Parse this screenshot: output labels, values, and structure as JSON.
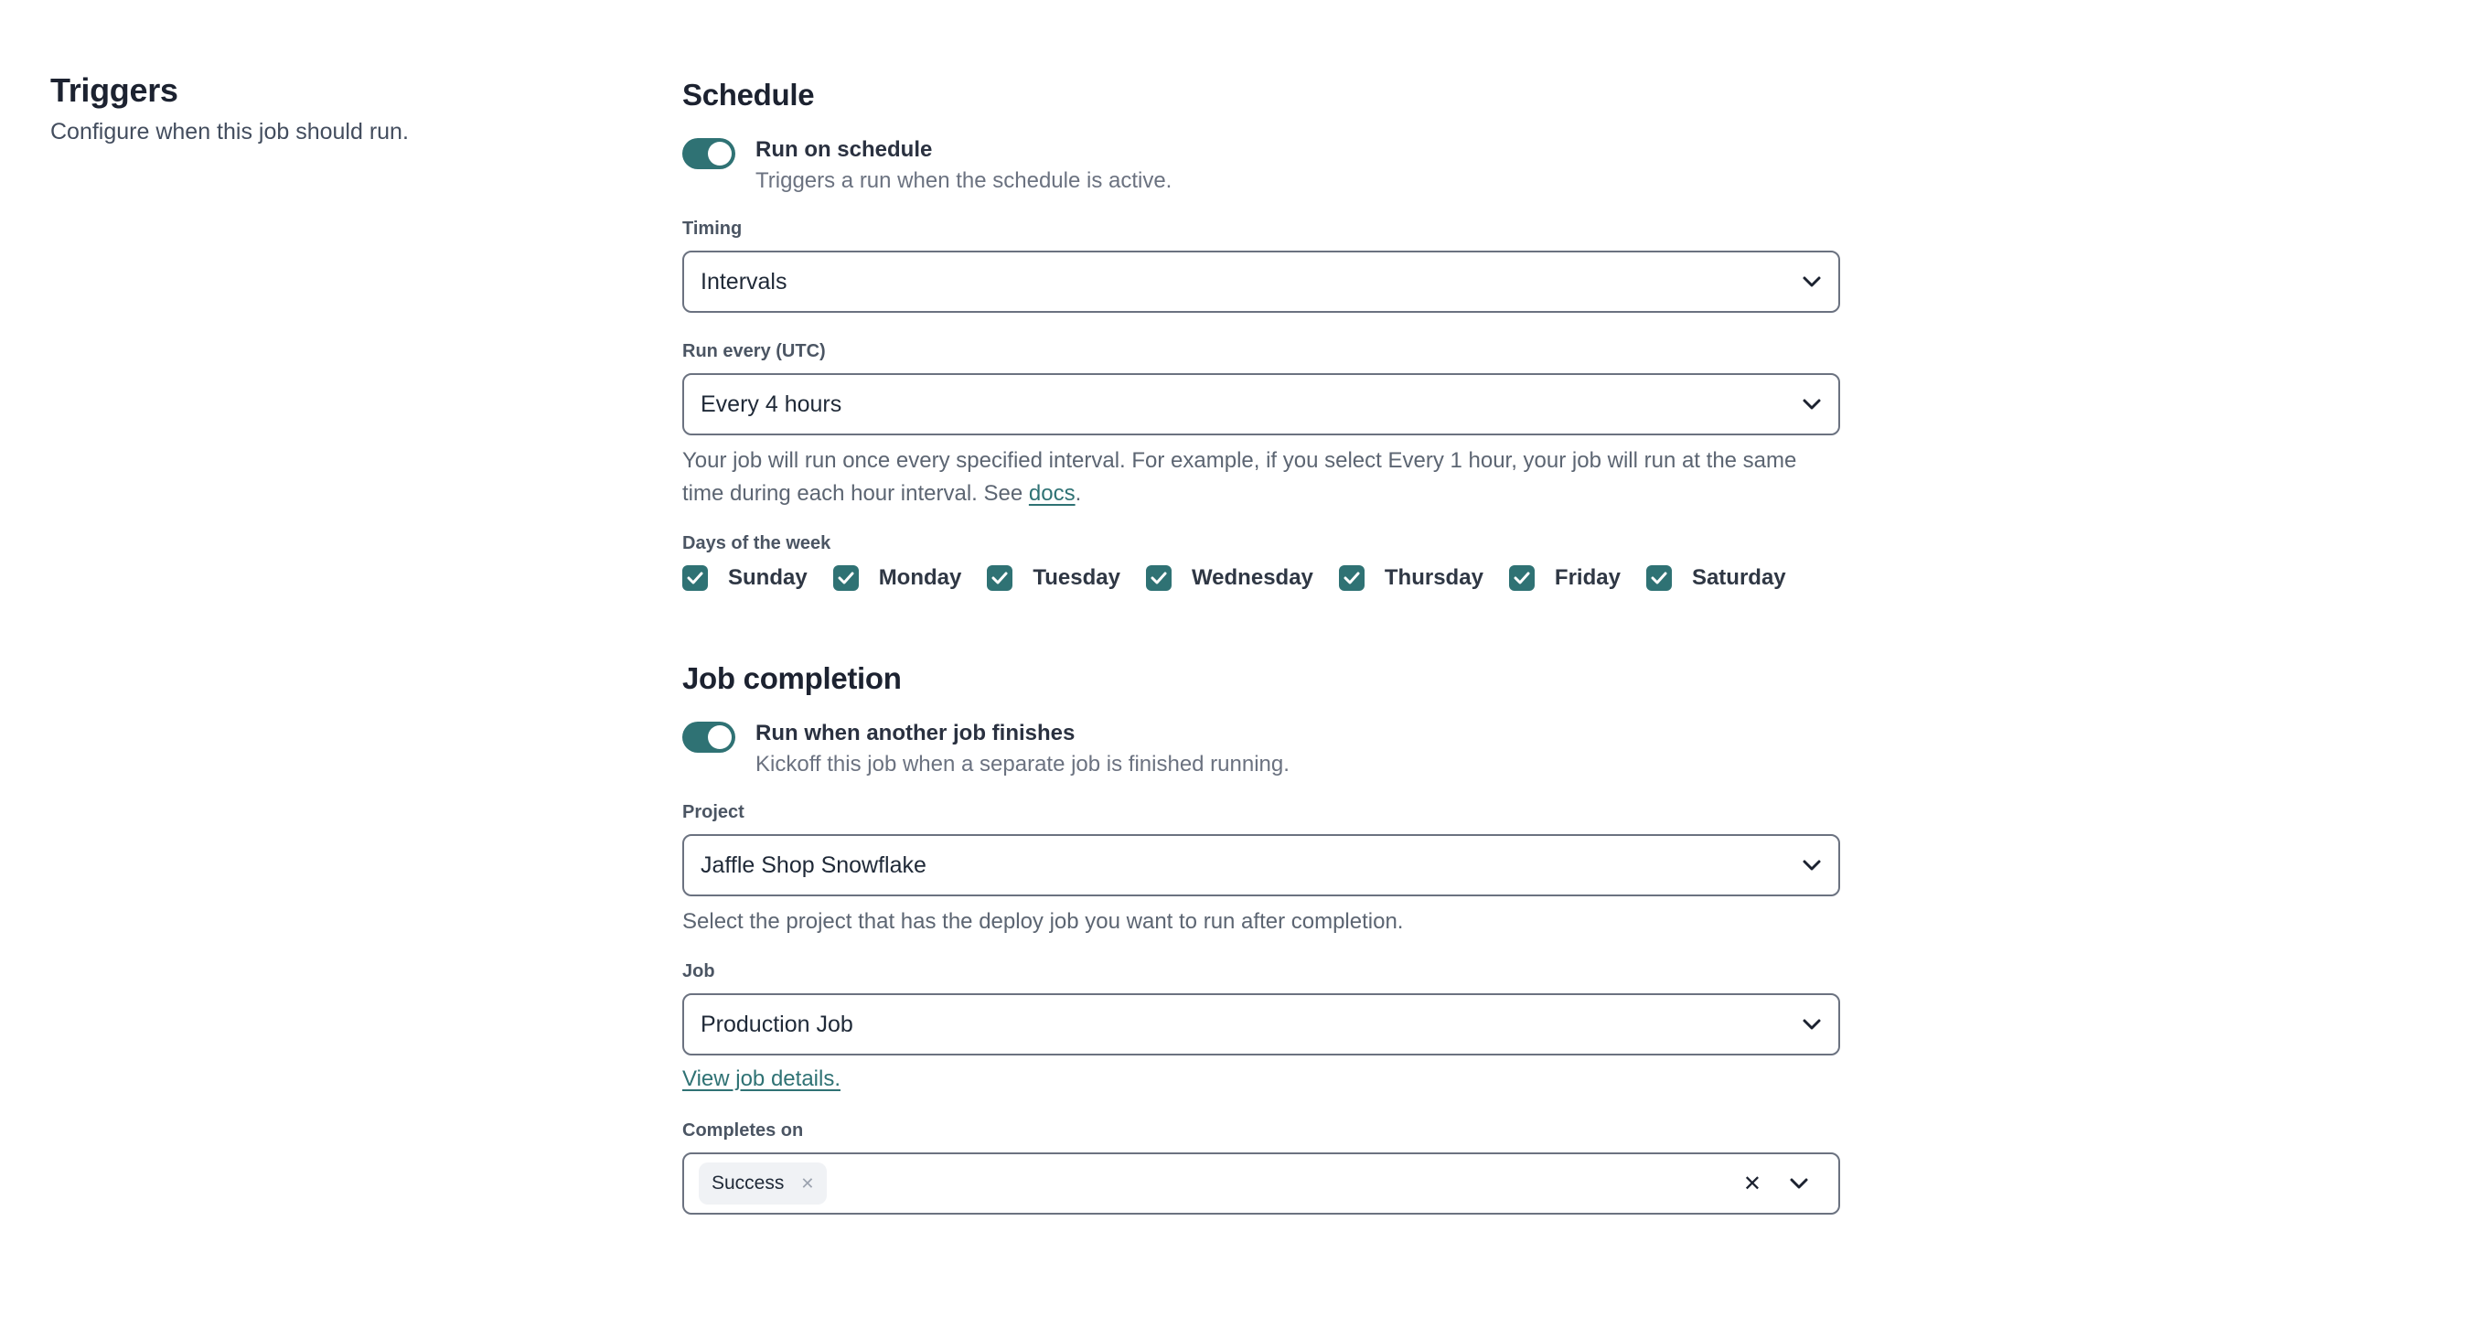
{
  "sidebar": {
    "title": "Triggers",
    "description": "Configure when this job should run."
  },
  "schedule": {
    "title": "Schedule",
    "toggle": {
      "label": "Run on schedule",
      "description": "Triggers a run when the schedule is active.",
      "on": true
    },
    "timing": {
      "label": "Timing",
      "value": "Intervals"
    },
    "run_every": {
      "label": "Run every (UTC)",
      "value": "Every 4 hours"
    },
    "help_text": "Your job will run once every specified interval. For example, if you select Every 1 hour, your job will run at the same time during each hour interval. See ",
    "help_link": "docs",
    "help_suffix": ".",
    "days": {
      "label": "Days of the week",
      "items": [
        {
          "label": "Sunday",
          "checked": true
        },
        {
          "label": "Monday",
          "checked": true
        },
        {
          "label": "Tuesday",
          "checked": true
        },
        {
          "label": "Wednesday",
          "checked": true
        },
        {
          "label": "Thursday",
          "checked": true
        },
        {
          "label": "Friday",
          "checked": true
        },
        {
          "label": "Saturday",
          "checked": true
        }
      ]
    }
  },
  "job_completion": {
    "title": "Job completion",
    "toggle": {
      "label": "Run when another job finishes",
      "description": "Kickoff this job when a separate job is finished running.",
      "on": true
    },
    "project": {
      "label": "Project",
      "value": "Jaffle Shop Snowflake",
      "help": "Select the project that has the deploy job you want to run after completion."
    },
    "job": {
      "label": "Job",
      "value": "Production Job",
      "link": "View job details."
    },
    "completes_on": {
      "label": "Completes on",
      "tags": [
        "Success"
      ]
    }
  },
  "colors": {
    "accent": "#2f7274",
    "border": "#6b7280",
    "tag_bg": "#f0f2f5"
  }
}
